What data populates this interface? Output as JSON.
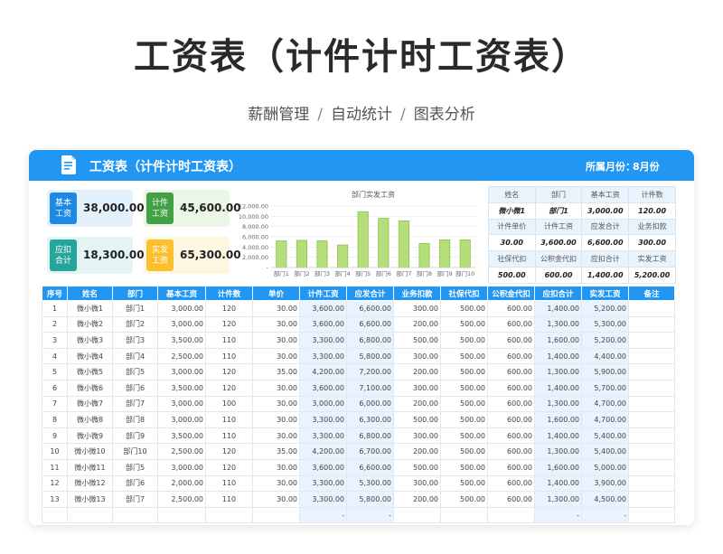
{
  "page": {
    "title": "工资表（计件计时工资表）",
    "subtitle_parts": [
      "薪酬管理",
      "自动统计",
      "图表分析"
    ],
    "separator": "/"
  },
  "header": {
    "title": "工资表（计件计时工资表）",
    "month_label": "所属月份：",
    "month_value": "8月份",
    "icon": "document-icon"
  },
  "kpis": [
    {
      "label": "基本工资",
      "value": "38,000.00",
      "color": "#1e88e5",
      "bg": "#e3f1fd"
    },
    {
      "label": "计件工资",
      "value": "45,600.00",
      "color": "#43a047",
      "bg": "#eaf6e6"
    },
    {
      "label": "应扣合计",
      "value": "18,300.00",
      "color": "#26a69a",
      "bg": "#e3f5f3"
    },
    {
      "label": "实发工资",
      "value": "65,300.00",
      "color": "#fbc02d",
      "bg": "#fdf6e0"
    }
  ],
  "chart_data": {
    "type": "bar",
    "title": "部门实发工资",
    "categories": [
      "部门1",
      "部门2",
      "部门3",
      "部门4",
      "部门5",
      "部门6",
      "部门7",
      "部门8",
      "部门9",
      "部门10"
    ],
    "values": [
      5200,
      5300,
      5200,
      4400,
      10900,
      9600,
      9100,
      4700,
      5400,
      5400
    ],
    "yticks": [
      "12,000.00",
      "10,000.00",
      "8,000.00",
      "6,000.00",
      "4,000.00",
      "2,000.00",
      "-"
    ],
    "ylim": [
      0,
      12000
    ],
    "grid": true,
    "bar_color": "#b5de7a",
    "bar_border": "#8bc34a"
  },
  "summary": [
    [
      "姓名",
      "部门",
      "基本工资",
      "计件数"
    ],
    [
      "微小微1",
      "部门1",
      "3,000.00",
      "120.00"
    ],
    [
      "计件单价",
      "计件工资",
      "应发合计",
      "业务扣款"
    ],
    [
      "30.00",
      "3,600.00",
      "6,600.00",
      "300.00"
    ],
    [
      "社保代扣",
      "公积金代扣",
      "应扣合计",
      "实发工资"
    ],
    [
      "500.00",
      "600.00",
      "1,400.00",
      "5,200.00"
    ]
  ],
  "table": {
    "columns": [
      "序号",
      "姓名",
      "部门",
      "基本工资",
      "计件数",
      "单价",
      "计件工资",
      "应发合计",
      "业务扣款",
      "社保代扣",
      "公积金代扣",
      "应扣合计",
      "实发工资",
      "备注"
    ],
    "rows": [
      [
        "1",
        "微小微1",
        "部门1",
        "3,000.00",
        "120",
        "30.00",
        "3,600.00",
        "6,600.00",
        "300.00",
        "500.00",
        "600.00",
        "1,400.00",
        "5,200.00",
        ""
      ],
      [
        "2",
        "微小微2",
        "部门2",
        "3,000.00",
        "120",
        "30.00",
        "3,600.00",
        "6,600.00",
        "200.00",
        "500.00",
        "600.00",
        "1,300.00",
        "5,300.00",
        ""
      ],
      [
        "3",
        "微小微3",
        "部门3",
        "3,500.00",
        "110",
        "30.00",
        "3,300.00",
        "6,800.00",
        "500.00",
        "500.00",
        "600.00",
        "1,600.00",
        "5,200.00",
        ""
      ],
      [
        "4",
        "微小微4",
        "部门4",
        "2,500.00",
        "110",
        "30.00",
        "3,300.00",
        "5,800.00",
        "300.00",
        "500.00",
        "600.00",
        "1,400.00",
        "4,400.00",
        ""
      ],
      [
        "5",
        "微小微5",
        "部门5",
        "3,000.00",
        "120",
        "35.00",
        "4,200.00",
        "7,200.00",
        "200.00",
        "500.00",
        "600.00",
        "1,300.00",
        "5,900.00",
        ""
      ],
      [
        "6",
        "微小微6",
        "部门6",
        "3,500.00",
        "120",
        "30.00",
        "3,600.00",
        "7,100.00",
        "300.00",
        "500.00",
        "600.00",
        "1,400.00",
        "5,700.00",
        ""
      ],
      [
        "7",
        "微小微7",
        "部门7",
        "3,000.00",
        "100",
        "30.00",
        "3,000.00",
        "6,000.00",
        "200.00",
        "500.00",
        "600.00",
        "1,300.00",
        "4,700.00",
        ""
      ],
      [
        "8",
        "微小微8",
        "部门8",
        "3,000.00",
        "110",
        "30.00",
        "3,300.00",
        "6,300.00",
        "500.00",
        "500.00",
        "600.00",
        "1,600.00",
        "4,700.00",
        ""
      ],
      [
        "9",
        "微小微9",
        "部门9",
        "3,500.00",
        "110",
        "30.00",
        "3,300.00",
        "6,800.00",
        "300.00",
        "500.00",
        "600.00",
        "1,400.00",
        "5,400.00",
        ""
      ],
      [
        "10",
        "微小微10",
        "部门10",
        "2,500.00",
        "120",
        "35.00",
        "4,200.00",
        "6,700.00",
        "200.00",
        "500.00",
        "600.00",
        "1,300.00",
        "5,400.00",
        ""
      ],
      [
        "11",
        "微小微11",
        "部门5",
        "3,000.00",
        "120",
        "30.00",
        "3,600.00",
        "6,600.00",
        "500.00",
        "500.00",
        "600.00",
        "1,600.00",
        "5,000.00",
        ""
      ],
      [
        "12",
        "微小微12",
        "部门6",
        "2,000.00",
        "110",
        "30.00",
        "3,300.00",
        "5,300.00",
        "300.00",
        "500.00",
        "600.00",
        "1,400.00",
        "3,900.00",
        ""
      ],
      [
        "13",
        "微小微13",
        "部门7",
        "2,500.00",
        "110",
        "30.00",
        "3,300.00",
        "5,800.00",
        "200.00",
        "500.00",
        "600.00",
        "1,300.00",
        "4,500.00",
        ""
      ],
      [
        "",
        "",
        "",
        "",
        "",
        "",
        "-",
        "-",
        "",
        "",
        "",
        "-",
        "-",
        ""
      ]
    ]
  }
}
